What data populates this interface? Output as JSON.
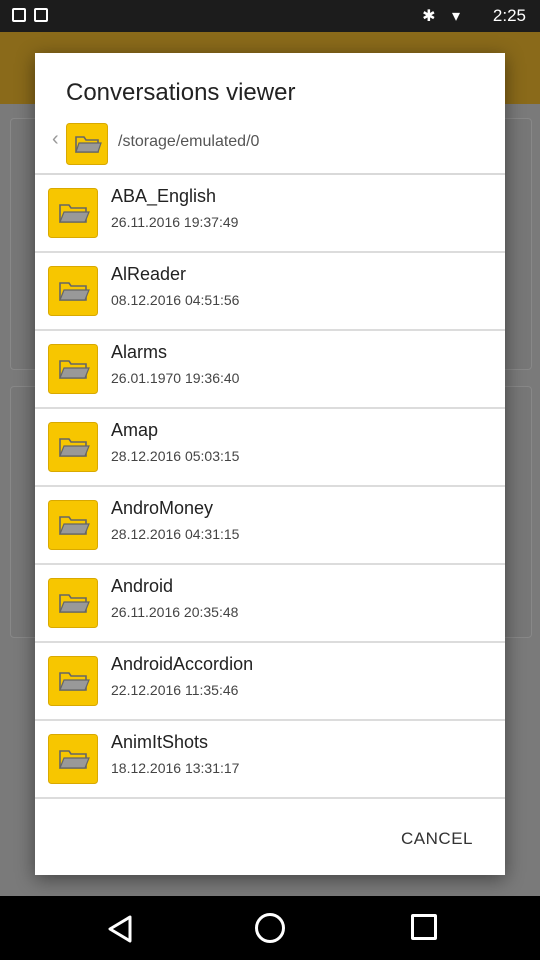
{
  "status_bar": {
    "time": "2:25",
    "icons": "✱ ▾"
  },
  "dialog": {
    "title": "Conversations viewer",
    "path": "/storage/emulated/0",
    "back_glyph": "‹",
    "items": [
      {
        "name": "ABA_English",
        "date": "26.11.2016 19:37:49"
      },
      {
        "name": "AlReader",
        "date": "08.12.2016 04:51:56"
      },
      {
        "name": "Alarms",
        "date": "26.01.1970 19:36:40"
      },
      {
        "name": "Amap",
        "date": "28.12.2016 05:03:15"
      },
      {
        "name": "AndroMoney",
        "date": "28.12.2016 04:31:15"
      },
      {
        "name": "Android",
        "date": "26.11.2016 20:35:48"
      },
      {
        "name": "AndroidAccordion",
        "date": "22.12.2016 11:35:46"
      },
      {
        "name": "AnimItShots",
        "date": "18.12.2016 13:31:17"
      }
    ],
    "cancel_label": "CANCEL"
  },
  "colors": {
    "folder": "#f7c600",
    "folder_border": "#d9a900",
    "toolbar": "#c9971f"
  }
}
